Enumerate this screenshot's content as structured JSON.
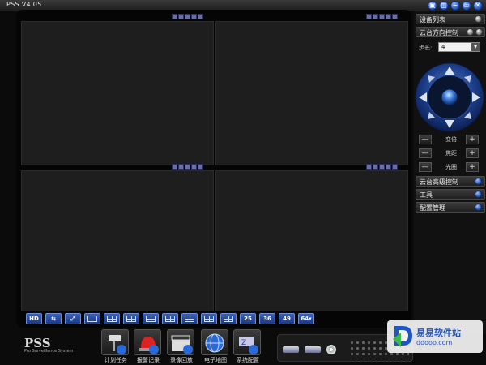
{
  "window": {
    "title": "PSS  V4.05",
    "buttons": [
      "▣",
      "◫",
      "−",
      "▭",
      "✕"
    ]
  },
  "layout_buttons": [
    "HD",
    "",
    "",
    "",
    "",
    "",
    "",
    "",
    "",
    "",
    "",
    "25",
    "36",
    "49",
    "64▾"
  ],
  "right_panel": {
    "device_list": "设备列表",
    "ptz_direction": "云台方向控制",
    "step_label": "步长:",
    "step_value": "4",
    "zoom_controls": [
      {
        "minus": "—",
        "label": "变倍",
        "plus": "+"
      },
      {
        "minus": "—",
        "label": "焦距",
        "plus": "+"
      },
      {
        "minus": "—",
        "label": "光圈",
        "plus": "+"
      }
    ],
    "ptz_advanced": "云台高级控制",
    "tools": "工具",
    "config_management": "配置管理"
  },
  "bottom": {
    "logo": "PSS",
    "logo_subtitle": "Pro Surveillance System",
    "functions": [
      "计划任务",
      "报警记录",
      "录像回放",
      "电子地图",
      "系统配置"
    ]
  },
  "watermark": {
    "text": "易易软件站",
    "url": "ddooo.com"
  },
  "colors": {
    "accent_blue": "#1e4bb0",
    "pane_bg": "#1e1e1e"
  }
}
